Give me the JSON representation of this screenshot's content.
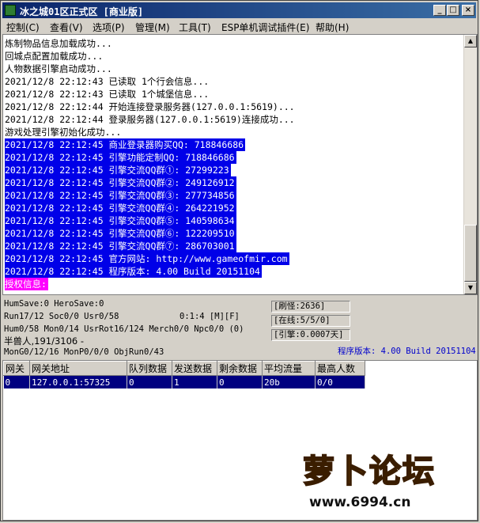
{
  "window": {
    "title": "冰之城01区正式区 [商业版]",
    "controls": {
      "minimize": "_",
      "maximize": "□",
      "close": "×"
    }
  },
  "menu": [
    "控制(C)",
    "查看(V)",
    "选项(P)",
    "管理(M)",
    "工具(T)",
    "ESP单机调试插件(E)",
    "帮助(H)"
  ],
  "log": {
    "lines": [
      {
        "text": "炼制物品信息加载成功...",
        "style": "normal"
      },
      {
        "text": "回城点配置加载成功...",
        "style": "normal"
      },
      {
        "text": "人物数据引擎启动成功...",
        "style": "normal"
      },
      {
        "text": "2021/12/8 22:12:43 已读取 1个行会信息...",
        "style": "normal"
      },
      {
        "text": "2021/12/8 22:12:43 已读取 1个城堡信息...",
        "style": "normal"
      },
      {
        "text": "2021/12/8 22:12:44 开始连接登录服务器(127.0.0.1:5619)...",
        "style": "normal"
      },
      {
        "text": "2021/12/8 22:12:44 登录服务器(127.0.0.1:5619)连接成功...",
        "style": "normal"
      },
      {
        "text": "游戏处理引擎初始化成功...",
        "style": "normal"
      },
      {
        "text": "2021/12/8 22:12:45 商业登录器购买QQ: 718846686",
        "style": "sel"
      },
      {
        "text": "2021/12/8 22:12:45 引擎功能定制QQ: 718846686",
        "style": "sel"
      },
      {
        "text": "2021/12/8 22:12:45 引擎交流QQ群①: 27299223",
        "style": "sel"
      },
      {
        "text": "2021/12/8 22:12:45 引擎交流QQ群②: 249126912",
        "style": "sel"
      },
      {
        "text": "2021/12/8 22:12:45 引擎交流QQ群③: 277734856",
        "style": "sel"
      },
      {
        "text": "2021/12/8 22:12:45 引擎交流QQ群④: 264221952",
        "style": "sel"
      },
      {
        "text": "2021/12/8 22:12:45 引擎交流QQ群⑤: 140598634",
        "style": "sel"
      },
      {
        "text": "2021/12/8 22:12:45 引擎交流QQ群⑥: 122209510",
        "style": "sel"
      },
      {
        "text": "2021/12/8 22:12:45 引擎交流QQ群⑦: 286703001",
        "style": "sel"
      },
      {
        "text": "2021/12/8 22:12:45 官方网站: http://www.gameofmir.com",
        "style": "sel"
      },
      {
        "text": "2021/12/8 22:12:45 程序版本: 4.00 Build 20151104",
        "style": "sel"
      },
      {
        "text": "授权信息:",
        "style": "auth"
      }
    ]
  },
  "status": {
    "line1": "HumSave:0 HeroSave:0",
    "line2": "Run17/12 Soc0/0 Usr0/58",
    "line2b": "0:1:4 [M][F]",
    "line3": "Hum0/58 Mon0/14 UsrRot16/124 Merch0/0 Npc0/0 (0)",
    "line4": "半兽人,191/3106 -",
    "line5": "MonG0/12/16 MonP0/0/0 ObjRun0/43",
    "refresh": "[刷怪:2636]",
    "online": "[在线:5/5/0]",
    "engine": "[引擎:0.0007天]",
    "version": "程序版本: 4.00 Build 20151104"
  },
  "gateway_table": {
    "columns": [
      "网关",
      "网关地址",
      "队列数据",
      "发送数据",
      "剩余数据",
      "平均流量",
      "最高人数"
    ],
    "rows": [
      [
        "0",
        "127.0.0.1:57325",
        "0",
        "1",
        "0",
        "20b",
        "0/0"
      ]
    ]
  },
  "watermark": {
    "logo_text": "萝卜论坛",
    "url": "www.6994.cn"
  },
  "colors": {
    "selection": "#0000e8",
    "auth": "#ff00ff",
    "titlebar": "#0a246a"
  }
}
